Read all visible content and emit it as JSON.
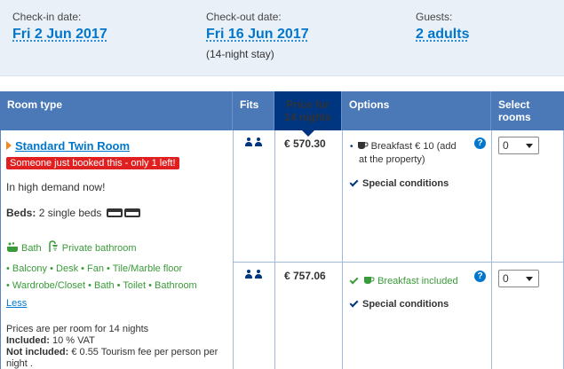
{
  "search": {
    "checkin_label": "Check-in date:",
    "checkin_value": "Fri 2 Jun 2017",
    "checkout_label": "Check-out date:",
    "checkout_value": "Fri 16 Jun 2017",
    "stay_length": "(14-night stay)",
    "guests_label": "Guests:",
    "guests_value": "2 adults"
  },
  "table": {
    "headers": {
      "room_type": "Room type",
      "fits": "Fits",
      "price_line1": "Price for",
      "price_line2": "14 nights",
      "options": "Options",
      "select_line1": "Select",
      "select_line2": "rooms"
    },
    "room": {
      "name": "Standard Twin Room",
      "urgency": "Someone just booked this - only 1 left!",
      "demand": "In high demand now!",
      "beds_label": "Beds:",
      "beds_value": "2 single beds",
      "facilities_line1": [
        "Bath",
        "Private bathroom"
      ],
      "facilities_line2": "• Balcony • Desk • Fan • Tile/Marble floor",
      "facilities_line3": "• Wardrobe/Closet • Bath • Toilet • Bathroom",
      "less_link": "Less",
      "pricing_note": "Prices are per room for 14 nights",
      "included_label": "Included:",
      "included_value": "10 % VAT",
      "not_included_label": "Not included:",
      "not_included_value": "€ 0.55 Tourism fee per person per night ."
    },
    "rates": [
      {
        "price": "€ 570.30",
        "breakfast_line1": "Breakfast € 10 (add",
        "breakfast_line2": "at the property)",
        "conditions": "Special conditions",
        "select_value": "0"
      },
      {
        "price": "€ 757.06",
        "breakfast_line1": "Breakfast included",
        "conditions": "Special conditions",
        "select_value": "0"
      }
    ]
  },
  "colors": {
    "header_blue": "#4b79b8",
    "price_header": "#003580",
    "link_blue": "#0077cc",
    "urgency_red": "#e02020",
    "facility_green": "#3a9b3a"
  },
  "icons": [
    "person-icon",
    "bed-icon",
    "bath-icon",
    "shower-icon",
    "coffee-cup-icon",
    "check-icon",
    "info-icon",
    "chevron-down-icon"
  ]
}
